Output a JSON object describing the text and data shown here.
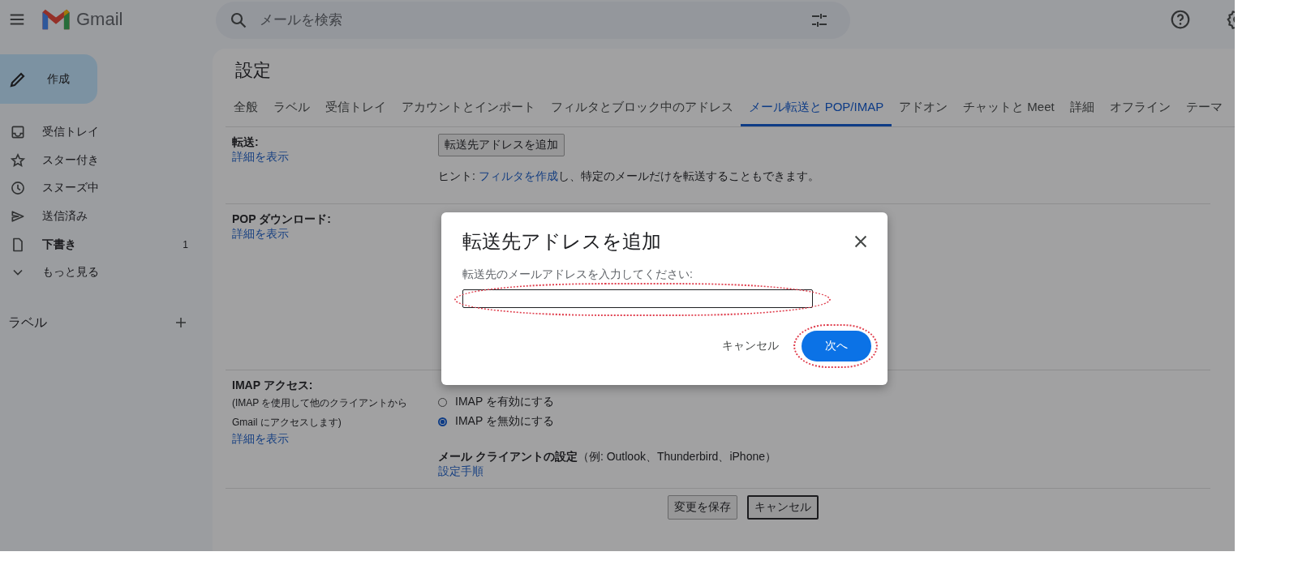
{
  "header": {
    "app_name": "Gmail",
    "search": {
      "placeholder": "メールを検索"
    }
  },
  "sidebar": {
    "compose": "作成",
    "items": [
      {
        "kind": "inbox",
        "label": "受信トレイ",
        "unread": false
      },
      {
        "kind": "star",
        "label": "スター付き",
        "unread": false
      },
      {
        "kind": "clock",
        "label": "スヌーズ中",
        "unread": false
      },
      {
        "kind": "send",
        "label": "送信済み",
        "unread": false
      },
      {
        "kind": "draft",
        "label": "下書き",
        "unread": true,
        "count": "1"
      },
      {
        "kind": "more",
        "label": "もっと見る",
        "unread": false
      }
    ],
    "labels_heading": "ラベル"
  },
  "settings": {
    "title": "設定",
    "tabs": [
      {
        "label": "全般",
        "selected": false
      },
      {
        "label": "ラベル",
        "selected": false
      },
      {
        "label": "受信トレイ",
        "selected": false
      },
      {
        "label": "アカウントとインポート",
        "selected": false
      },
      {
        "label": "フィルタとブロック中のアドレス",
        "selected": false
      },
      {
        "label": "メール転送と POP/IMAP",
        "selected": true
      },
      {
        "label": "アドオン",
        "selected": false
      },
      {
        "label": "チャットと Meet",
        "selected": false
      },
      {
        "label": "詳細",
        "selected": false
      },
      {
        "label": "オフライン",
        "selected": false
      },
      {
        "label": "テーマ",
        "selected": false
      }
    ],
    "forwarding": {
      "label": "転送:",
      "link": "詳細を表示",
      "button": "転送先アドレスを追加",
      "hint": {
        "before": "ヒント: ",
        "link": "フィルタを作成",
        "after": "し、特定のメールだけを転送することもできます。"
      }
    },
    "pop": {
      "label": "POP ダウンロード:",
      "link": "詳細を表示"
    },
    "imap": {
      "label": "IMAP アクセス:",
      "description": "(IMAP を使用して他のクライアントから Gmail にアクセスします)",
      "link": "詳細を表示",
      "options": [
        {
          "label": "IMAP を有効にする",
          "selected": false
        },
        {
          "label": "IMAP を無効にする",
          "selected": true
        }
      ],
      "client_heading": "メール クライアントの設定",
      "client_note": "（例: Outlook、Thunderbird、iPhone）",
      "client_link": "設定手順"
    },
    "footer_buttons": [
      {
        "label": "変更を保存",
        "focused": false
      },
      {
        "label": "キャンセル",
        "focused": true
      }
    ]
  },
  "dialog": {
    "title": "転送先アドレスを追加",
    "field_label": "転送先のメールアドレスを入力してください:",
    "input_highlighted": true,
    "cancel": "キャンセル",
    "next": "次へ",
    "next_highlighted": true
  }
}
